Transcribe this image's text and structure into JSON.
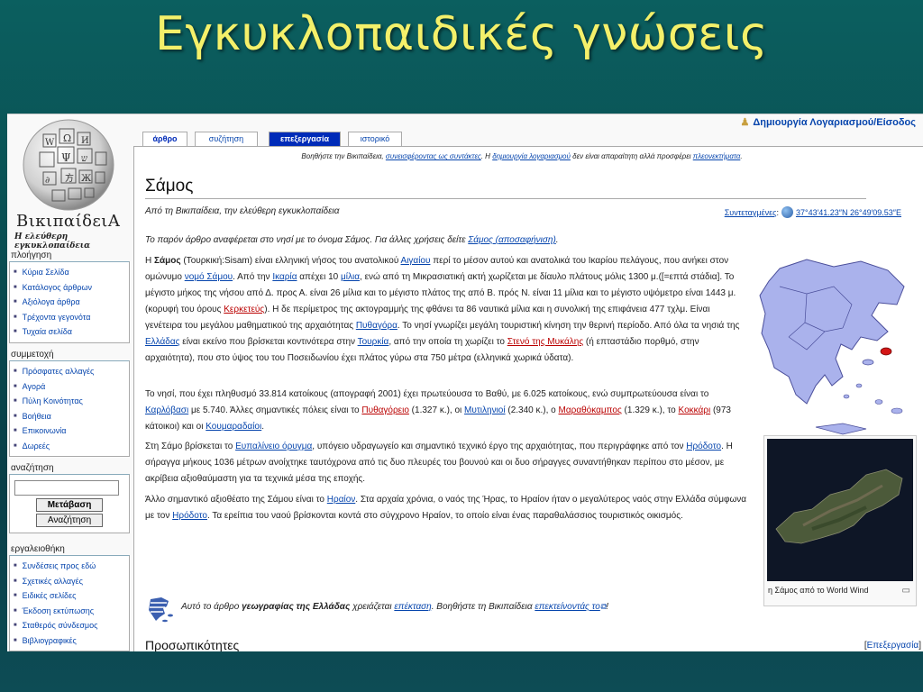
{
  "slide": {
    "title": "Εγκυκλοπαιδικές γνώσεις"
  },
  "logo": {
    "name": "ΒικιπαίδειΑ",
    "slogan": "Η ελεύθερη εγκυκλοπαίδεια"
  },
  "sidebar": {
    "navigation": {
      "title": "πλοήγηση",
      "items": [
        "Κύρια Σελίδα",
        "Κατάλογος άρθρων",
        "Αξιόλογα άρθρα",
        "Τρέχοντα γεγονότα",
        "Τυχαία σελίδα"
      ]
    },
    "community": {
      "title": "συμμετοχή",
      "items": [
        "Πρόσφατες αλλαγές",
        "Αγορά",
        "Πύλη Κοινότητας",
        "Βοήθεια",
        "Επικοινωνία",
        "Δωρεές"
      ]
    },
    "search": {
      "title": "αναζήτηση",
      "go_label": "Μετάβαση",
      "search_label": "Αναζήτηση"
    },
    "toolbox": {
      "title": "εργαλειοθήκη",
      "items": [
        "Συνδέσεις προς εδώ",
        "Σχετικές αλλαγές",
        "Ειδικές σελίδες",
        "Έκδοση εκτύπωσης",
        "Σταθερός σύνδεσμος",
        "Βιβλιογραφικές"
      ]
    }
  },
  "personal": {
    "login": "Δημιουργία Λογαριασμού/Είσοδος"
  },
  "tabs": [
    "άρθρο",
    "συζήτηση",
    "επεξεργασία",
    "ιστορικό"
  ],
  "sitenotice": {
    "t1": "Βοηθήστε την Βικιπαίδεια, ",
    "l1": "συνεισφέροντας ως συντάκτες",
    "t2": ". Η ",
    "l2": "δημιουργία λογαριασμού",
    "t3": " δεν είναι απαραίτητη αλλά προσφέρει ",
    "l3": "πλεονεκτήματα",
    "t4": "."
  },
  "article": {
    "title": "Σάμος",
    "from": "Από τη Βικιπαίδεια, την ελεύθερη εγκυκλοπαίδεια",
    "coords_label": "Συντεταγμένες",
    "coords_value": "37°43′41.23″N 26°49′09.53″E",
    "dablink_text": "Το παρόν άρθρο αναφέρεται στο νησί με το όνομα Σάμος. Για άλλες χρήσεις δείτε ",
    "dablink_link": "Σάμος (αποσαφήνιση)",
    "image_caption": "η Σάμος από το World Wind"
  },
  "stub": {
    "t1": "Αυτό το άρθρο ",
    "b1": "γεωγραφίας της Ελλάδας",
    "t2": " χρειάζεται ",
    "l1": "επέκταση",
    "t3": ". Βοηθήστε τη Βικιπαίδεια ",
    "l2": "επεκτείνοντάς το",
    "t4": "!"
  },
  "section": {
    "title": "Προσωπικότητες",
    "edit": "Επεξεργασία"
  }
}
